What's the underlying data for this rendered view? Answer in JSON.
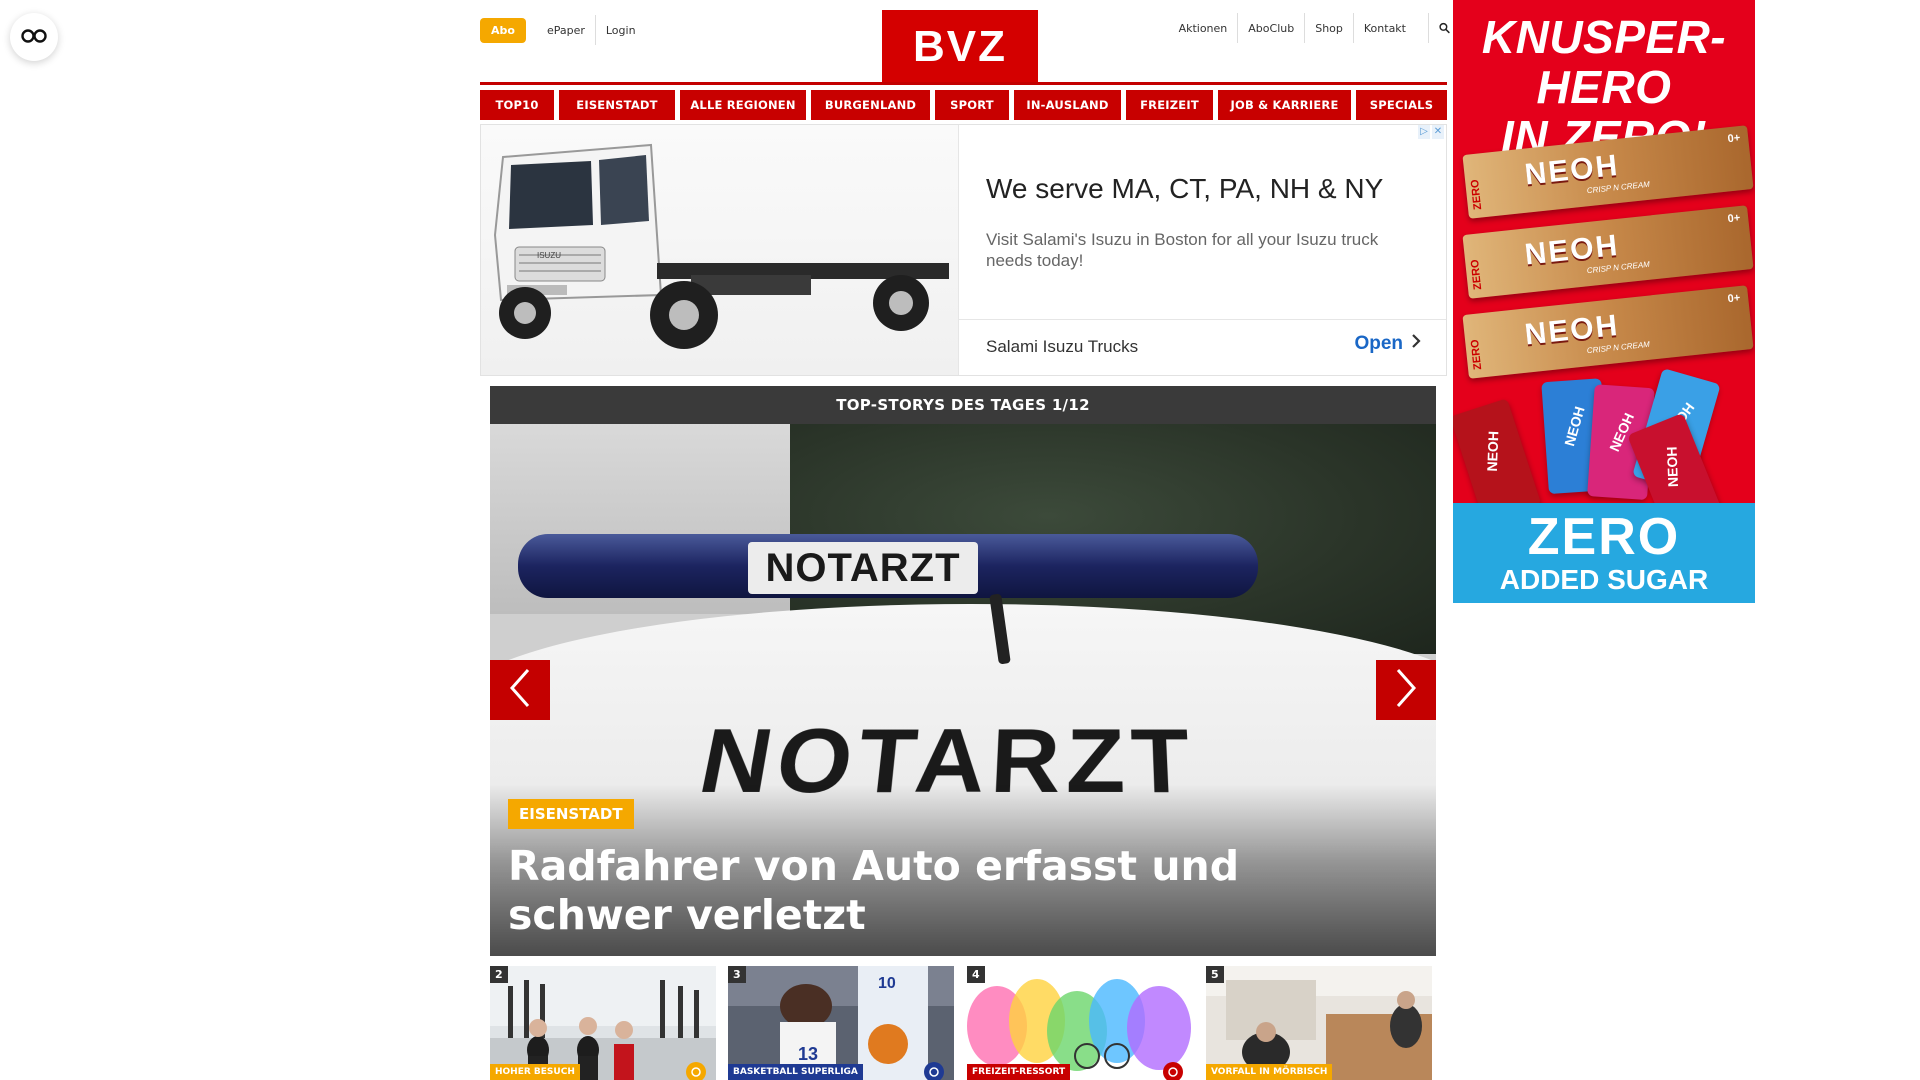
{
  "floating_button": {
    "icon": "glasses-icon"
  },
  "header": {
    "abo_label": "Abo",
    "left_links": [
      "ePaper",
      "Login"
    ],
    "logo_text": "BVZ",
    "right_links": [
      "Aktionen",
      "AboClub",
      "Shop",
      "Kontakt"
    ],
    "search_icon": "search-icon",
    "brand_color": "#d40000",
    "accent_color": "#f5a800"
  },
  "nav": {
    "items": [
      "TOP10",
      "EISENSTADT",
      "ALLE REGIONEN",
      "BURGENLAND",
      "SPORT",
      "IN-AUSLAND",
      "FREIZEIT",
      "JOB & KARRIERE",
      "SPECIALS"
    ]
  },
  "ad": {
    "headline": "We serve MA, CT, PA, NH & NY",
    "description": "Visit Salami's Isuzu in Boston for all your Isuzu truck needs today!",
    "advertiser": "Salami Isuzu Trucks",
    "cta": "Open",
    "truck_badge": "ISUZU"
  },
  "top_stories": {
    "header": "TOP-STORYS DES TAGES 1/12",
    "hero": {
      "category": "EISENSTADT",
      "title": "Radfahrer von Auto erfasst und schwer verletzt",
      "lightbar_text": "NOTARZT",
      "vehicle_text": "NOTARZT"
    },
    "thumbnails": [
      {
        "number": "2",
        "tag": "HOHER BESUCH",
        "tag_color": "#f5a800",
        "icon": "star-icon"
      },
      {
        "number": "3",
        "tag": "BASKETBALL SUPERLIGA",
        "tag_color": "#1f3a93",
        "icon": "lock-icon"
      },
      {
        "number": "4",
        "tag": "FREIZEIT-RESSORT",
        "tag_color": "#c80000",
        "icon": "lock-icon"
      },
      {
        "number": "5",
        "tag": "VORFALL IN MÖRBISCH",
        "tag_color": "#f5a800",
        "icon": "lock-icon"
      }
    ]
  },
  "sidebar_ad": {
    "title_line1": "KNUSPER-HERO",
    "title_line2": "IN ZERO!",
    "bar_brand": "NEOH",
    "bar_sub": "CRISP N CREAM",
    "bar_zero": "ZERO",
    "bar_badge": "0+",
    "bottom_line1": "ZERO",
    "bottom_line2": "ADDED SUGAR"
  }
}
